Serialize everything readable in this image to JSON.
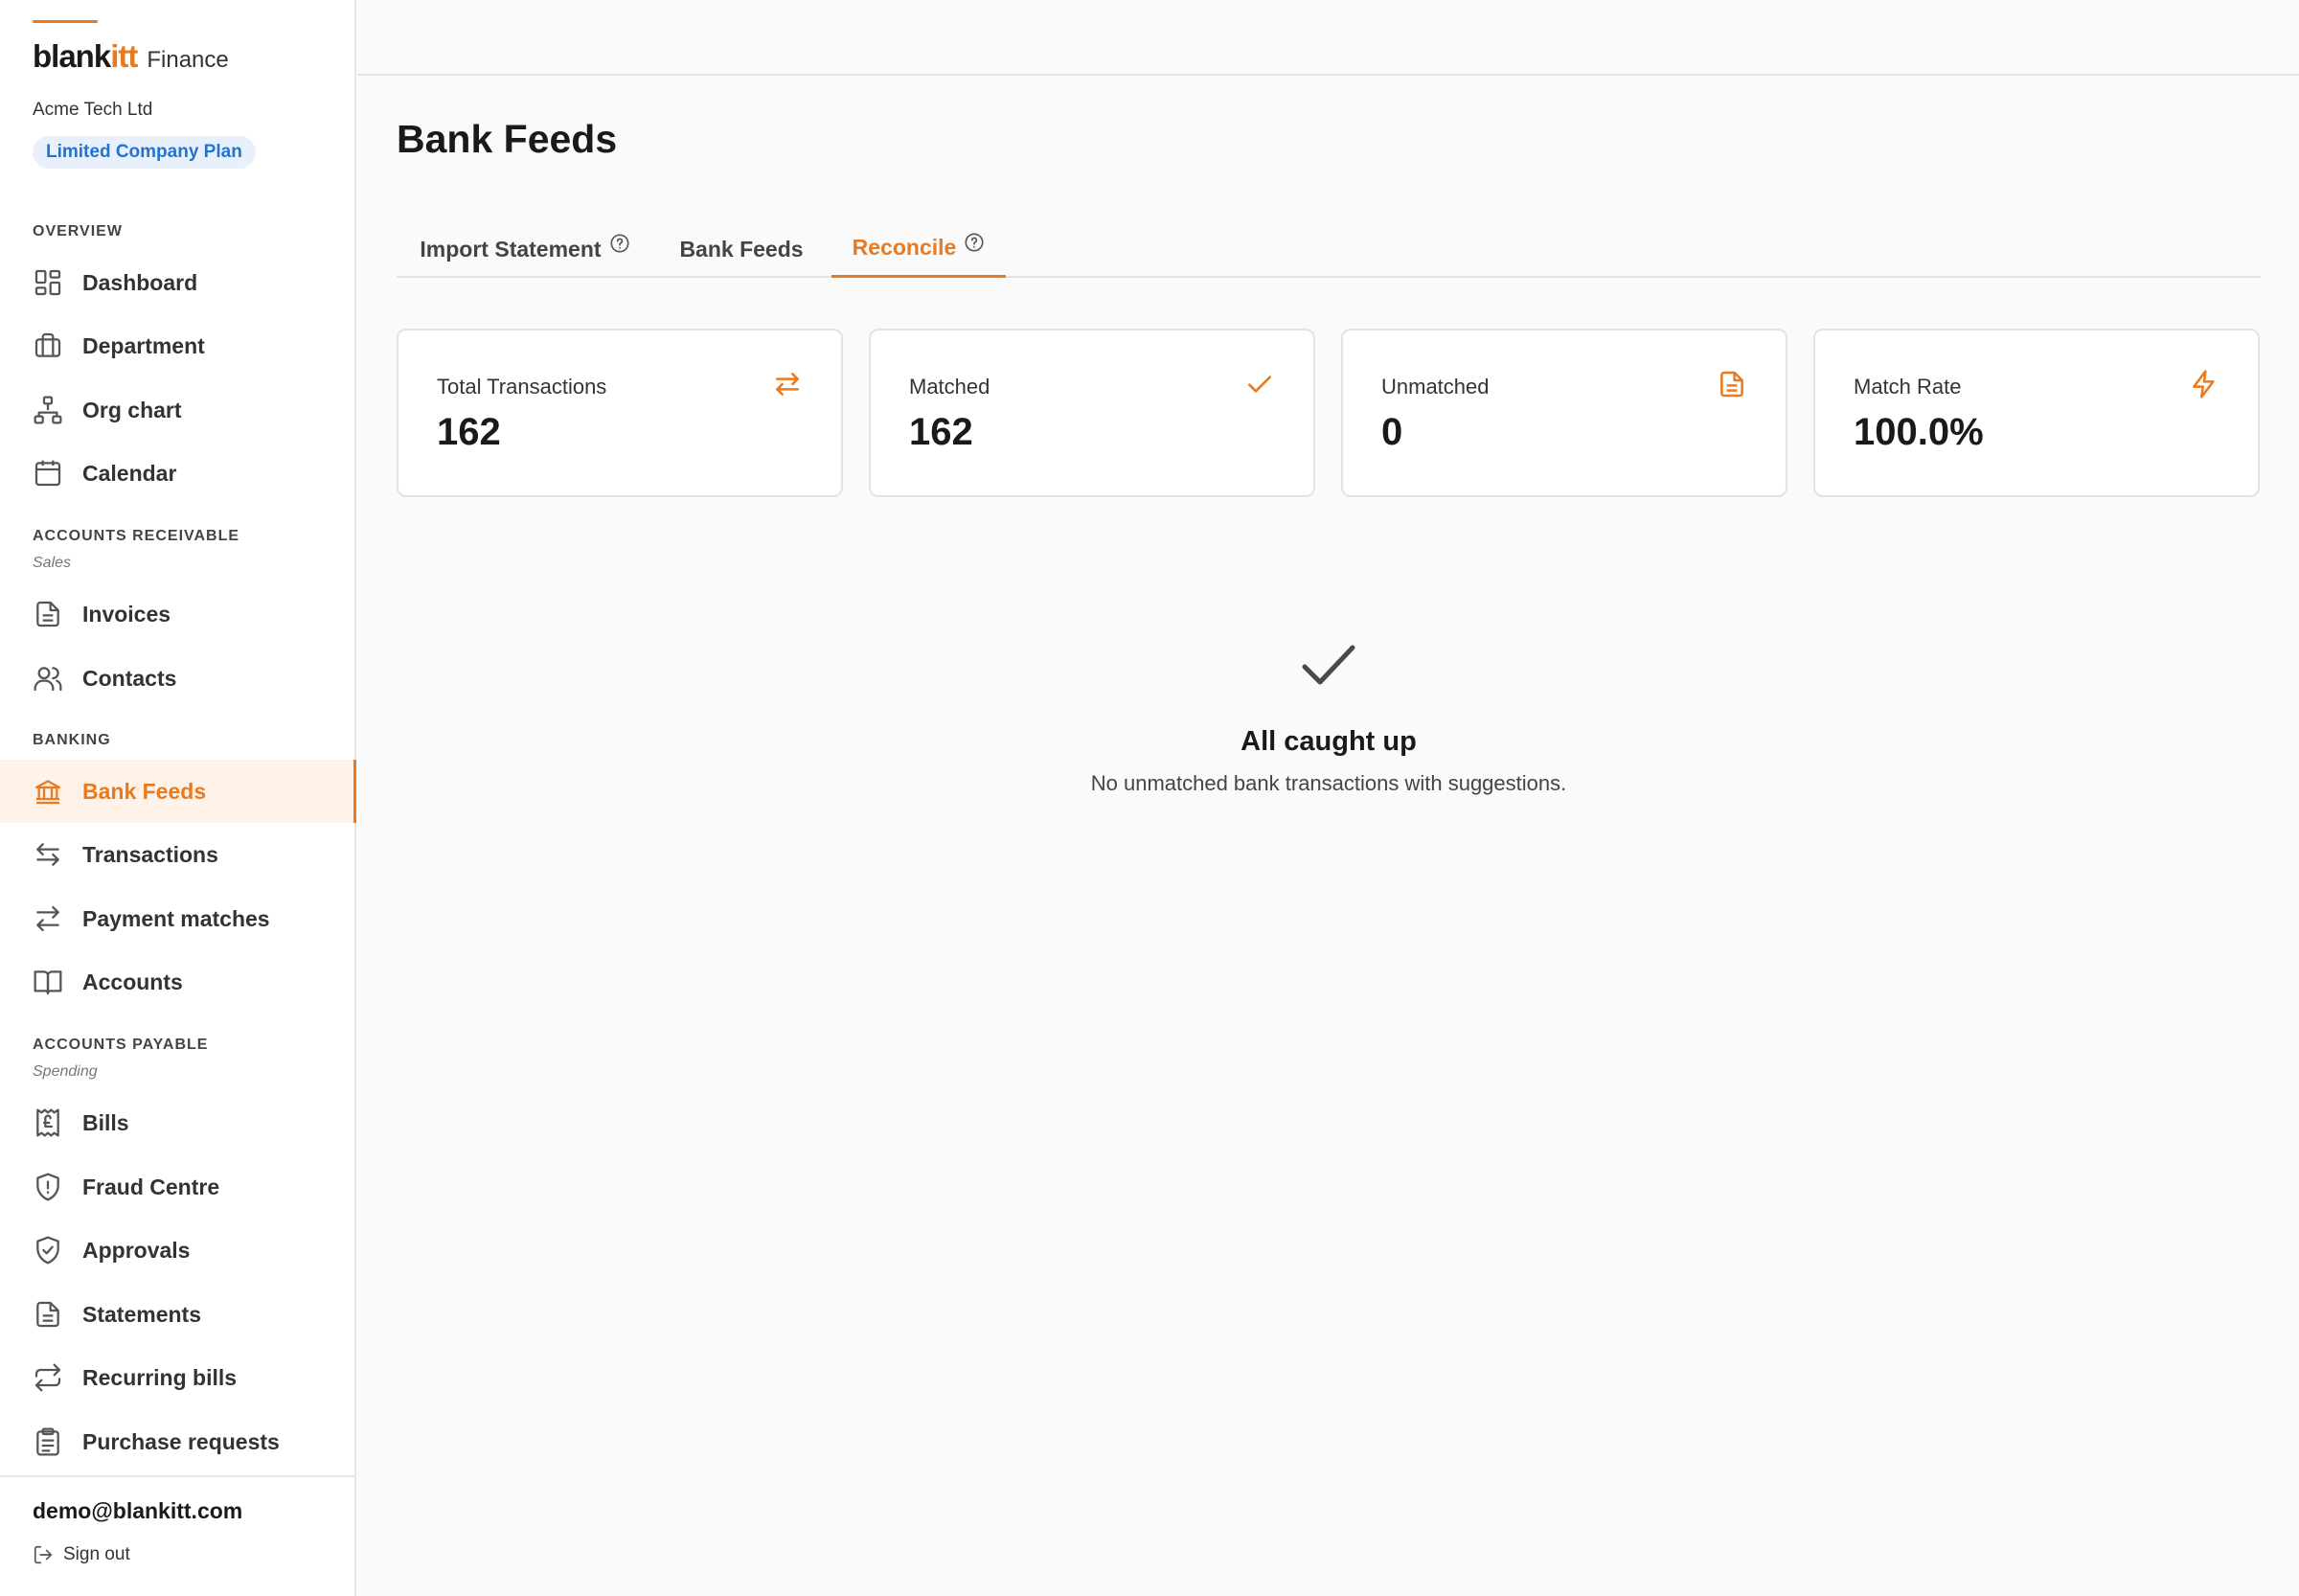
{
  "brand": {
    "logo_main": "blank",
    "logo_accent": "itt",
    "suffix": "Finance",
    "accent_color": "#e97a1f"
  },
  "org": {
    "company": "Acme Tech Ltd",
    "plan": "Limited Company Plan"
  },
  "sidebar": {
    "sections": [
      {
        "label": "OVERVIEW",
        "sub": ""
      },
      {
        "label": "ACCOUNTS RECEIVABLE",
        "sub": "Sales"
      },
      {
        "label": "BANKING",
        "sub": ""
      },
      {
        "label": "ACCOUNTS PAYABLE",
        "sub": "Spending"
      }
    ],
    "items": [
      {
        "label": "Dashboard",
        "icon": "dashboard-icon"
      },
      {
        "label": "Department",
        "icon": "briefcase-icon"
      },
      {
        "label": "Org chart",
        "icon": "org-chart-icon"
      },
      {
        "label": "Calendar",
        "icon": "calendar-icon"
      },
      {
        "label": "Invoices",
        "icon": "document-icon"
      },
      {
        "label": "Contacts",
        "icon": "users-icon"
      },
      {
        "label": "Bank Feeds",
        "icon": "bank-icon",
        "active": true
      },
      {
        "label": "Transactions",
        "icon": "arrows-left-right-icon"
      },
      {
        "label": "Payment matches",
        "icon": "arrows-swap-icon"
      },
      {
        "label": "Accounts",
        "icon": "book-icon"
      },
      {
        "label": "Bills",
        "icon": "pound-receipt-icon"
      },
      {
        "label": "Fraud Centre",
        "icon": "shield-alert-icon"
      },
      {
        "label": "Approvals",
        "icon": "shield-check-icon"
      },
      {
        "label": "Statements",
        "icon": "document-icon"
      },
      {
        "label": "Recurring bills",
        "icon": "repeat-icon"
      },
      {
        "label": "Purchase requests",
        "icon": "clipboard-icon"
      }
    ]
  },
  "user": {
    "email": "demo@blankitt.com",
    "sign_out": "Sign out"
  },
  "page": {
    "title": "Bank Feeds"
  },
  "tabs": [
    {
      "label": "Import Statement",
      "has_help": true
    },
    {
      "label": "Bank Feeds",
      "has_help": false
    },
    {
      "label": "Reconcile",
      "has_help": true,
      "active": true
    }
  ],
  "stats": [
    {
      "label": "Total Transactions",
      "value": "162",
      "icon": "arrows-left-right-icon"
    },
    {
      "label": "Matched",
      "value": "162",
      "icon": "check-icon"
    },
    {
      "label": "Unmatched",
      "value": "0",
      "icon": "document-icon"
    },
    {
      "label": "Match Rate",
      "value": "100.0%",
      "icon": "lightning-icon"
    }
  ],
  "empty_state": {
    "title": "All caught up",
    "subtitle": "No unmatched bank transactions with suggestions."
  }
}
